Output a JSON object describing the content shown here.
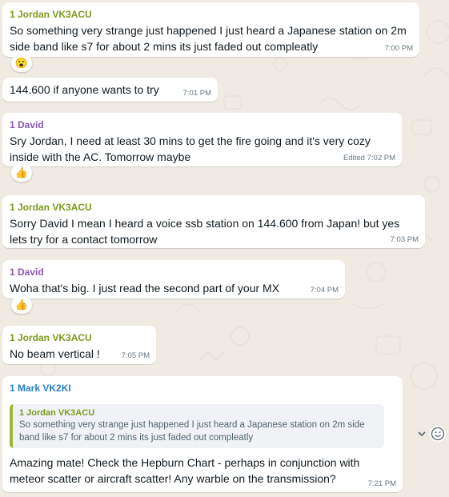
{
  "messages": [
    {
      "sender": "1 Jordan VK3ACU",
      "text": "So something very strange just happened I just heard a Japanese station on 2m side band like s7 for about 2 mins its just faded out compleatly",
      "time": "7:00 PM",
      "reaction": "😮"
    },
    {
      "sender": "",
      "text": "144.600 if anyone wants to try",
      "time": "7:01 PM"
    },
    {
      "sender": "1 David",
      "text": "Sry Jordan, I need at least 30 mins to get the fire going and it's very cozy inside with the AC. Tomorrow maybe",
      "time": "Edited 7:02 PM",
      "reaction": "👍"
    },
    {
      "sender": "1 Jordan VK3ACU",
      "text": "Sorry David I mean I heard a voice ssb station on 144.600 from Japan! but yes lets try for a contact tomorrow",
      "time": "7:03 PM"
    },
    {
      "sender": "1 David",
      "text": "Woha that's big. I just read the second part of your MX",
      "time": "7:04 PM",
      "reaction": "👍"
    },
    {
      "sender": "1 Jordan VK3ACU",
      "text": "No beam vertical !",
      "time": "7:05 PM"
    },
    {
      "sender": "1 Mark VK2KI",
      "quoted": {
        "sender": "1 Jordan VK3ACU",
        "text": "So something very strange just happened I just heard a Japanese station on 2m side band like s7 for about 2 mins its just faded out compleatly"
      },
      "text": "Amazing mate! Check the Hepburn Chart - perhaps in conjunction with meteor scatter or aircraft scatter!  Any warble on the transmission?",
      "time": "7:21 PM"
    }
  ],
  "icons": {
    "chevron": "chevron-down-icon",
    "emoji": "emoji-icon"
  },
  "colors": {
    "background": "#efeae2",
    "bubble": "#ffffff",
    "jordan": "#7c9a1b",
    "david": "#8a54b5",
    "mark": "#2a7fc8"
  }
}
